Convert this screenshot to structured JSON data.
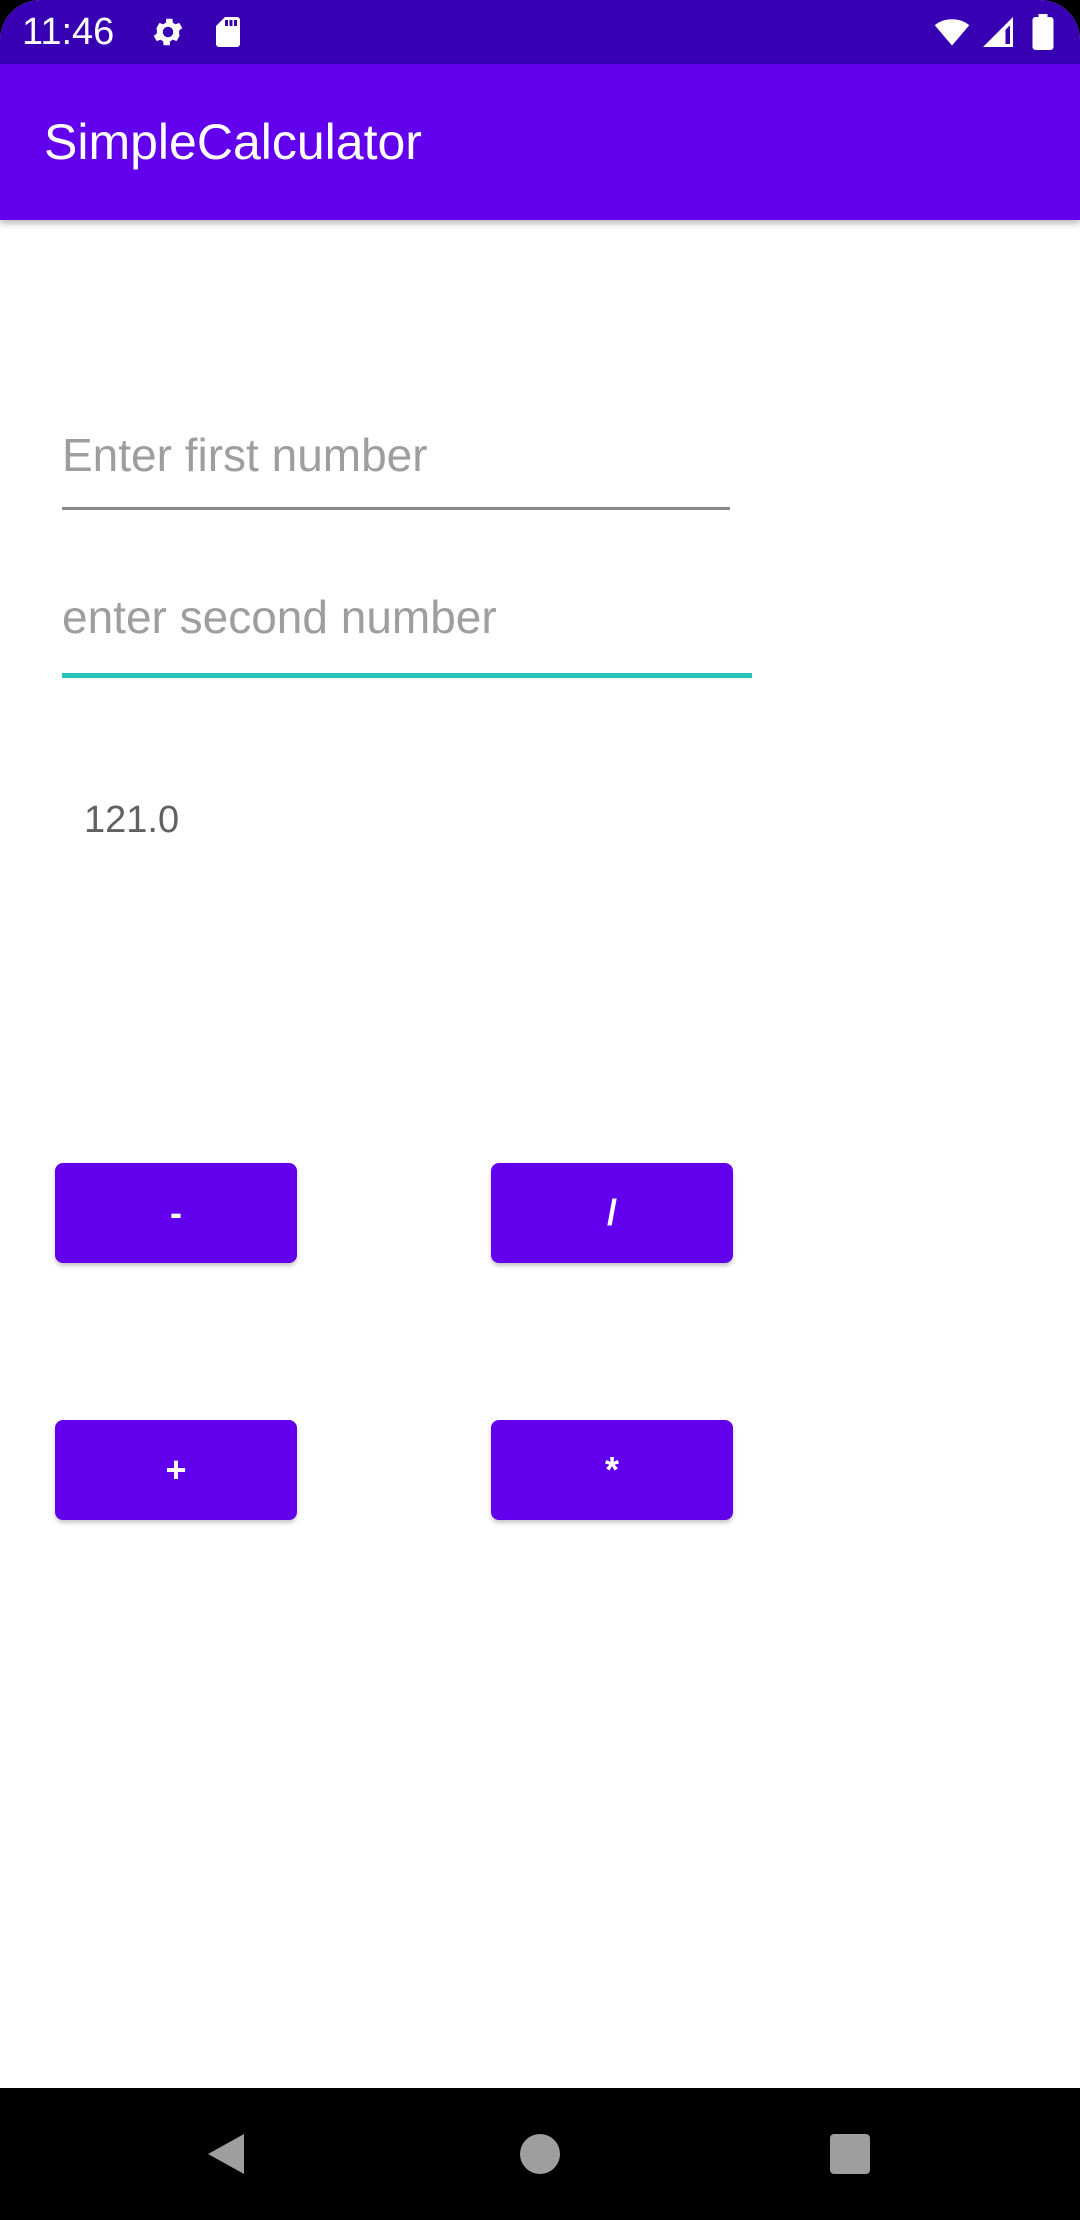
{
  "status_bar": {
    "time": "11:46",
    "icons": [
      "settings-gear-icon",
      "sd-card-icon",
      "wifi-icon",
      "cellular-signal-icon",
      "battery-icon"
    ],
    "background_color": "#3700b3"
  },
  "app_bar": {
    "title": "SimpleCalculator",
    "background_color": "#6200ee"
  },
  "inputs": {
    "first": {
      "value": "",
      "placeholder": "Enter first number"
    },
    "second": {
      "value": "",
      "placeholder": "enter second number",
      "focused": true
    }
  },
  "result": {
    "text": "121.0"
  },
  "buttons": {
    "minus_label": "-",
    "divide_label": "/",
    "plus_label": "+",
    "multiply_label": "*",
    "color": "#6200ee"
  },
  "nav_bar": {
    "icons": [
      "back-icon",
      "home-icon",
      "recents-icon"
    ]
  },
  "colors": {
    "focus_underline": "#26c6bd"
  }
}
